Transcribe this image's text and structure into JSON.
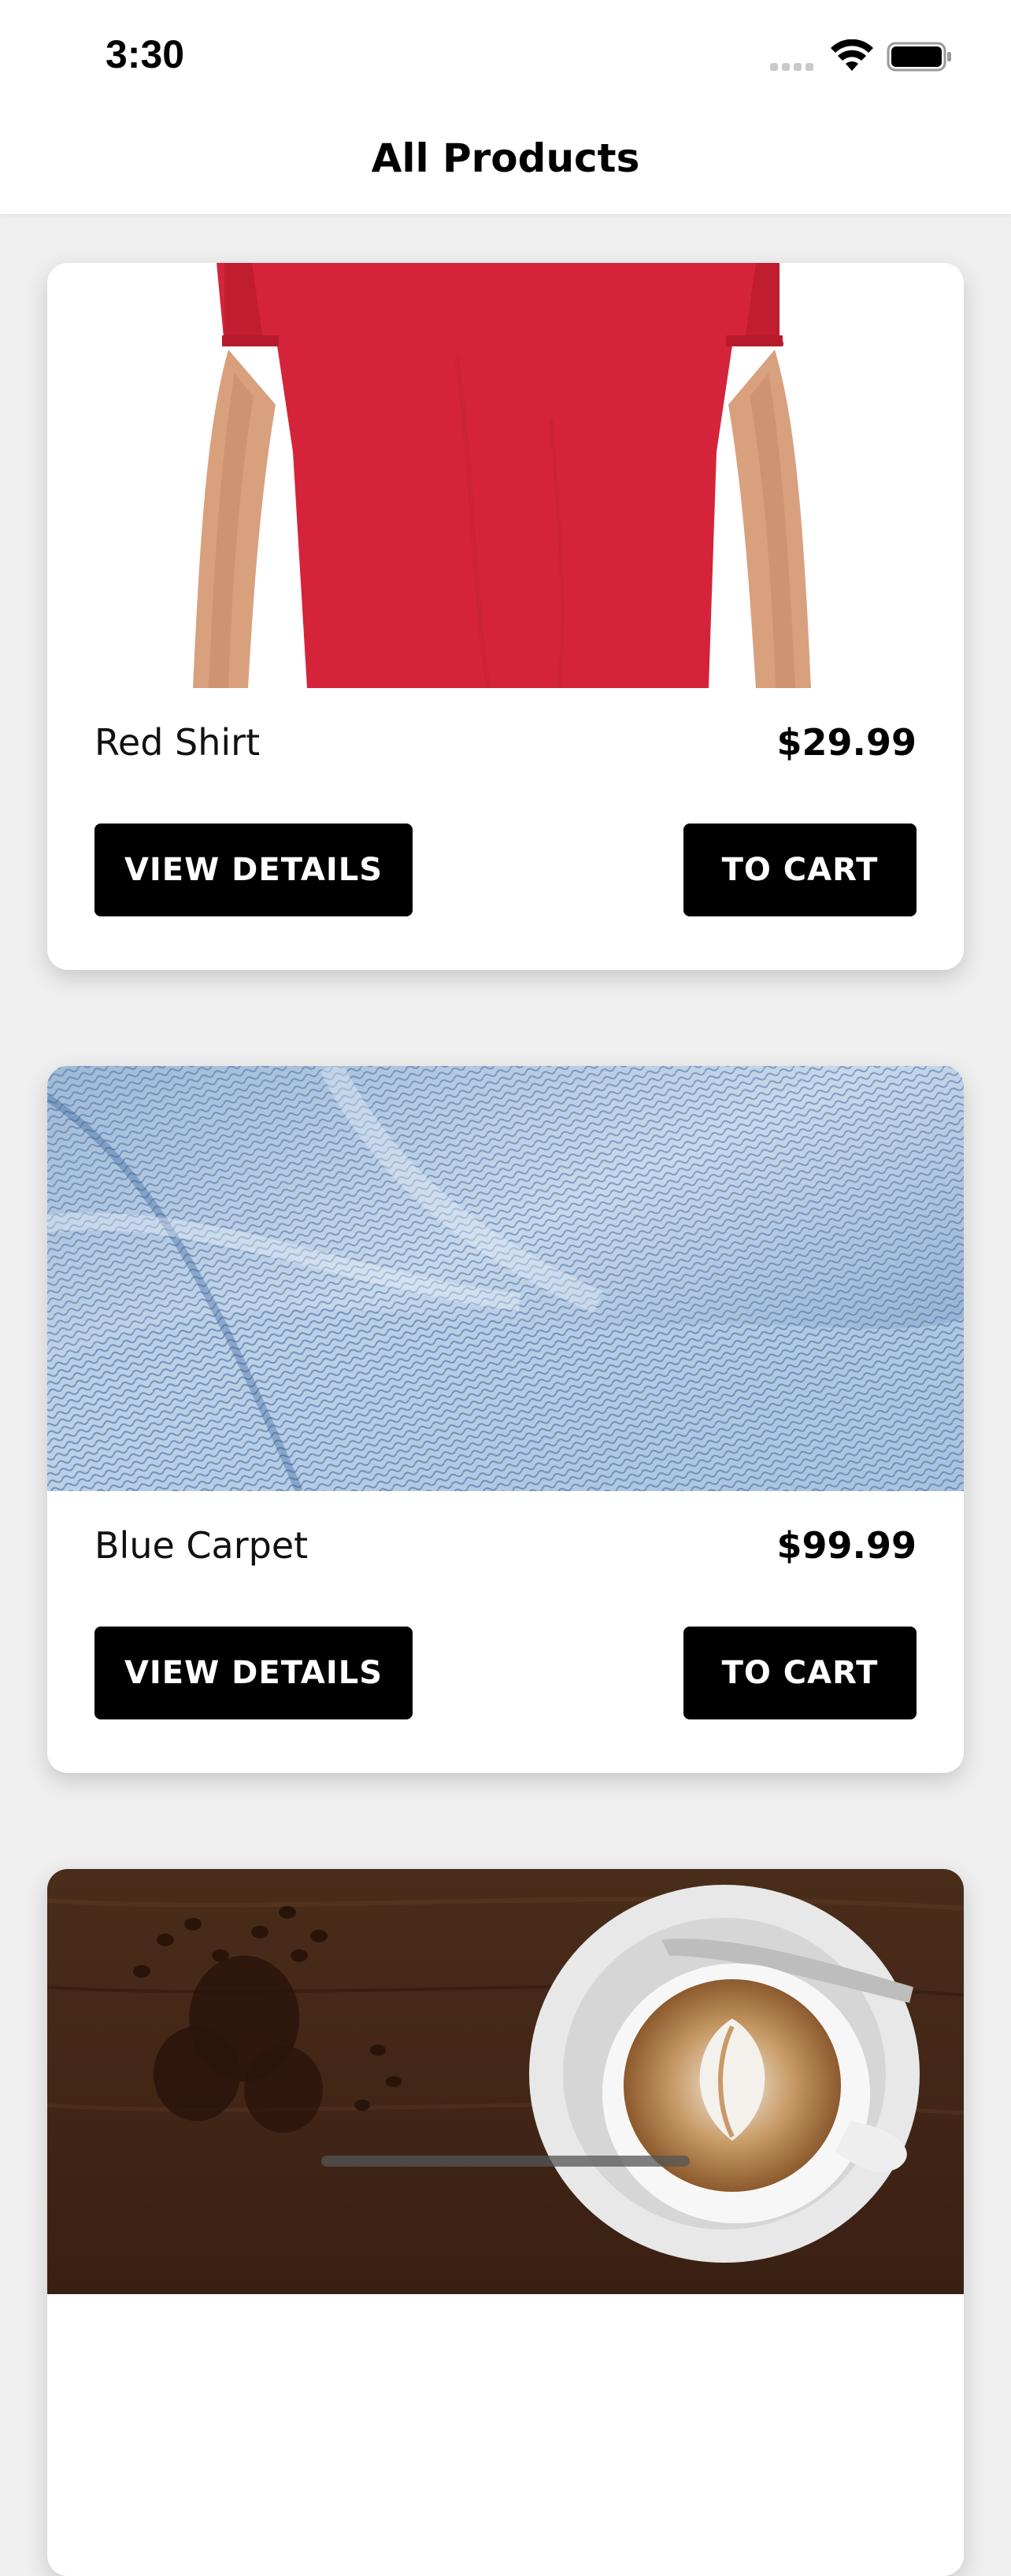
{
  "status_bar": {
    "time": "3:30",
    "icons": [
      "cellular-signal-icon",
      "wifi-icon",
      "battery-icon"
    ]
  },
  "header": {
    "title": "All Products"
  },
  "products": [
    {
      "name": "Red Shirt",
      "price": "$29.99",
      "image": "red-shirt-image",
      "view_details_label": "VIEW DETAILS",
      "to_cart_label": "TO CART"
    },
    {
      "name": "Blue Carpet",
      "price": "$99.99",
      "image": "blue-carpet-image",
      "view_details_label": "VIEW DETAILS",
      "to_cart_label": "TO CART"
    },
    {
      "image": "coffee-image"
    }
  ],
  "colors": {
    "background": "#efefef",
    "card": "#ffffff",
    "button": "#000000",
    "button_text": "#ffffff"
  }
}
